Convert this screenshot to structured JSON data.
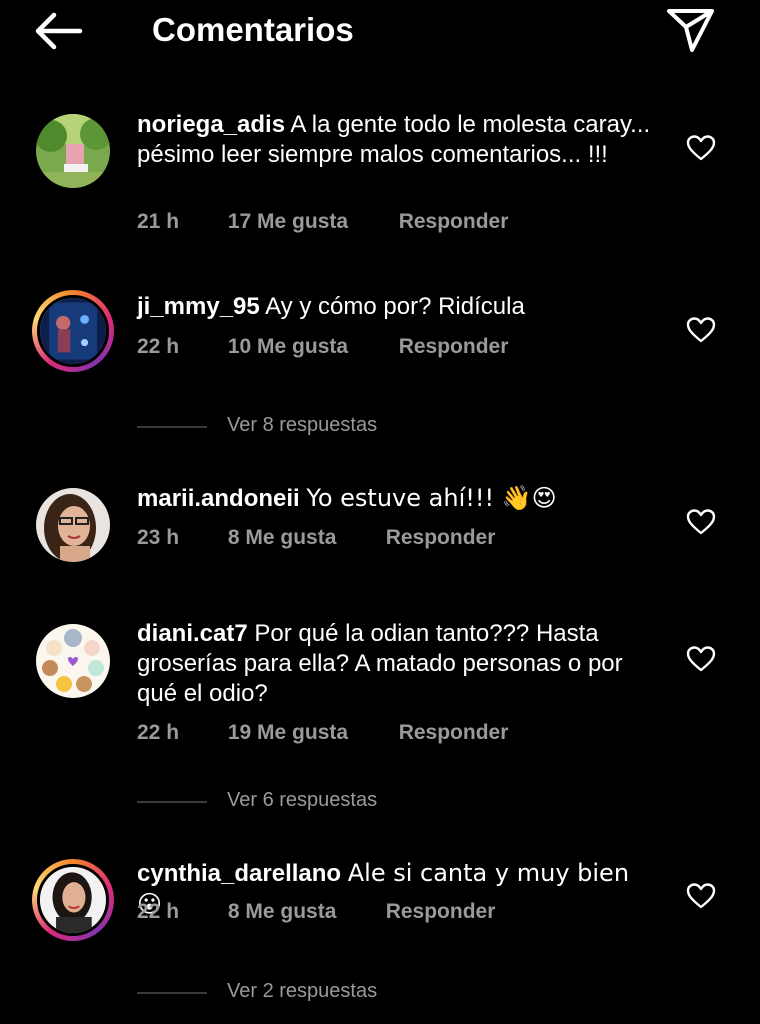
{
  "header": {
    "title": "Comentarios",
    "back_icon": "arrow-left-icon",
    "send_icon": "paper-plane-icon"
  },
  "comments": [
    {
      "username": "noriega_adis",
      "text": "A la gente todo le molesta caray... pésimo leer siempre malos comentarios... !!!",
      "time": "21 h",
      "likes": "17 Me gusta",
      "reply": "Responder",
      "story_ring": false
    },
    {
      "username": "ji_mmy_95",
      "text": "Ay y cómo por? Ridícula",
      "time": "22 h",
      "likes": "10 Me gusta",
      "reply": "Responder",
      "story_ring": true,
      "view_replies": "Ver 8 respuestas"
    },
    {
      "username": "marii.andoneii",
      "text": "Yo estuve ahí!!! 👋😍",
      "time": "23 h",
      "likes": "8 Me gusta",
      "reply": "Responder",
      "story_ring": false
    },
    {
      "username": "diani.cat7",
      "text": "Por qué la odian tanto??? Hasta groserías para ella? A matado personas o por qué el odio?",
      "time": "22 h",
      "likes": "19 Me gusta",
      "reply": "Responder",
      "story_ring": false,
      "view_replies": "Ver 6 respuestas"
    },
    {
      "username": "cynthia_darellano",
      "text": "Ale si canta y muy bien 😮",
      "time": "22 h",
      "likes": "8 Me gusta",
      "reply": "Responder",
      "story_ring": true,
      "view_replies": "Ver 2 respuestas"
    }
  ],
  "colors": {
    "background": "#000000",
    "meta": "#9a9a9a",
    "story_ring": [
      "#f58529",
      "#dd2a7b",
      "#8134af"
    ]
  }
}
